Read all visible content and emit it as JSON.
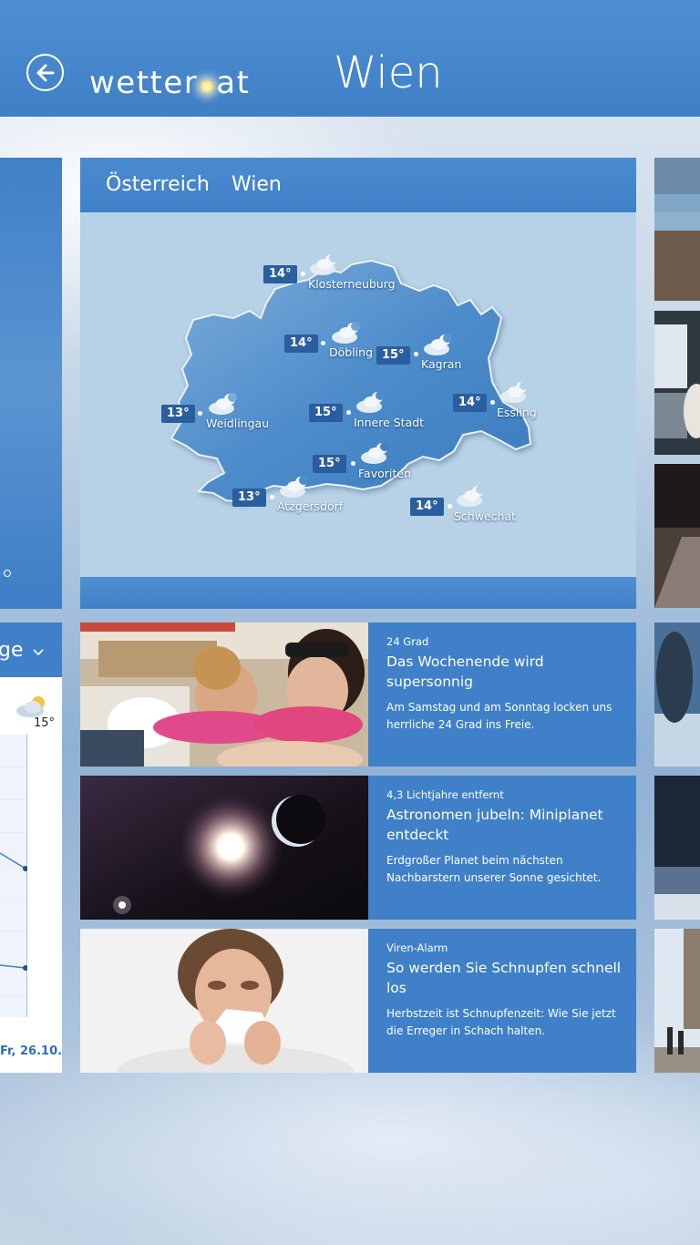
{
  "header": {
    "logo_left": "wetter",
    "logo_right": "at",
    "title": "Wien"
  },
  "left_panel": {
    "chart_header": "ge",
    "chart_temp": "15°",
    "chart_date": "Fr, 26.10."
  },
  "map": {
    "tabs": [
      "Österreich",
      "Wien"
    ],
    "locations": [
      {
        "temp": "14°",
        "name": "Klosterneuburg"
      },
      {
        "temp": "14°",
        "name": "Döbling"
      },
      {
        "temp": "15°",
        "name": "Kagran"
      },
      {
        "temp": "13°",
        "name": "Weidlingau"
      },
      {
        "temp": "15°",
        "name": "Innere Stadt"
      },
      {
        "temp": "14°",
        "name": "Essling"
      },
      {
        "temp": "15°",
        "name": "Favoriten"
      },
      {
        "temp": "13°",
        "name": "Atzgersdorf"
      },
      {
        "temp": "14°",
        "name": "Schwechat"
      }
    ]
  },
  "news": [
    {
      "kicker": "24 Grad",
      "title": "Das Wochenende wird supersonnig",
      "desc": "Am Samstag und am Sonntag locken uns herrliche 24 Grad ins Freie."
    },
    {
      "kicker": "4,3 Lichtjahre entfernt",
      "title": "Astronomen jubeln: Miniplanet entdeckt",
      "desc": "Erdgroßer Planet beim nächsten Nachbarstern unserer Sonne gesichtet."
    },
    {
      "kicker": "Viren-Alarm",
      "title": "So werden Sie Schnupfen schnell los",
      "desc": "Herbstzeit ist Schnupfenzeit: Wie Sie jetzt die Erreger in Schach halten."
    }
  ],
  "colors": {
    "accent": "#3f80c8",
    "badge": "#2b5e9e",
    "map_bg": "#b7d1e7"
  }
}
